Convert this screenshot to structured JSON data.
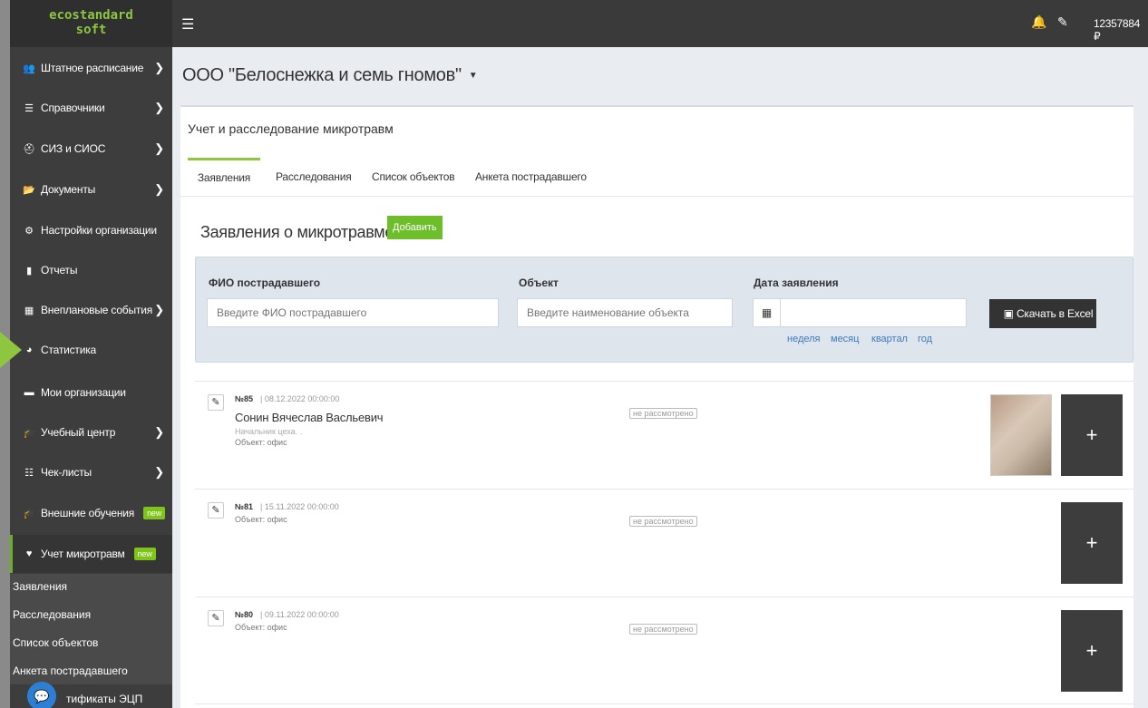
{
  "logo": {
    "line1": "ecostandard",
    "line2": "soft"
  },
  "sidebar": {
    "items": [
      {
        "label": "Штатное расписание",
        "icon": "users-icon",
        "glyph": "👥",
        "chevron": true
      },
      {
        "label": "Справочники",
        "icon": "list-icon",
        "glyph": "☰",
        "chevron": true
      },
      {
        "label": "СИЗ и СИОС",
        "icon": "hardhat-icon",
        "glyph": "⛑",
        "chevron": true
      },
      {
        "label": "Документы",
        "icon": "folder-icon",
        "glyph": "📂",
        "chevron": true
      },
      {
        "label": "Настройки организации",
        "icon": "gear-icon",
        "glyph": "⚙",
        "chevron": false
      },
      {
        "label": "Отчеты",
        "icon": "report-icon",
        "glyph": "▮",
        "chevron": false
      },
      {
        "label": "Внеплановые события",
        "icon": "calendar-icon",
        "glyph": "▦",
        "chevron": true
      },
      {
        "label": "Статистика",
        "icon": "pie-chart-icon",
        "glyph": "◕",
        "chevron": false
      },
      {
        "label": "Мои организации",
        "icon": "briefcase-icon",
        "glyph": "▬",
        "chevron": false
      },
      {
        "label": "Учебный центр",
        "icon": "graduation-cap-icon",
        "glyph": "🎓",
        "chevron": true
      },
      {
        "label": "Чек-листы",
        "icon": "checklist-icon",
        "glyph": "☷",
        "chevron": true
      },
      {
        "label": "Внешние обучения",
        "icon": "graduation-cap-icon",
        "glyph": "🎓",
        "chevron": false,
        "badge": "new"
      },
      {
        "label": "Учет микротравм",
        "icon": "heartbeat-icon",
        "glyph": "♥",
        "chevron": false,
        "badge": "new"
      }
    ],
    "submenu": [
      "Заявления",
      "Расследования",
      "Список объектов",
      "Анкета пострадавшего"
    ],
    "certs_label": "тификаты ЭЦП"
  },
  "topbar": {
    "menu_icon": "hamburger-icon",
    "balance": "12357884 ₽"
  },
  "org": {
    "title": "ООО \"Белоснежка и семь гномов\""
  },
  "panel": {
    "title": "Учет и расследование микротравм",
    "tabs": [
      "Заявления",
      "Расследования",
      "Список объектов",
      "Анкета пострадавшего"
    ],
    "active_tab": "Заявления",
    "section_title": "Заявления о микротравме",
    "add_label": "Добавить"
  },
  "filter": {
    "fio_label": "ФИО пострадавшего",
    "fio_placeholder": "Введите ФИО пострадавшего",
    "object_label": "Объект",
    "object_placeholder": "Введите наименование объекта",
    "date_label": "Дата заявления",
    "periods": [
      "неделя",
      "месяц",
      "квартал",
      "год"
    ],
    "excel_label": "Скачать в Excel"
  },
  "records": [
    {
      "num": "№85",
      "date": "08.12.2022 00:00:00",
      "name": "Сонин Вячеслав Васльевич",
      "position": "Начальник цеха. .",
      "object": "Объект: офис",
      "status": "не рассмотрено",
      "has_photo": true
    },
    {
      "num": "№81",
      "date": "15.11.2022 00:00:00",
      "name": "",
      "position": "",
      "object": "Объект: офис",
      "status": "не рассмотрено",
      "has_photo": false
    },
    {
      "num": "№80",
      "date": "09.11.2022 00:00:00",
      "name": "",
      "position": "",
      "object": "Объект: офис",
      "status": "не рассмотрено",
      "has_photo": false
    }
  ]
}
